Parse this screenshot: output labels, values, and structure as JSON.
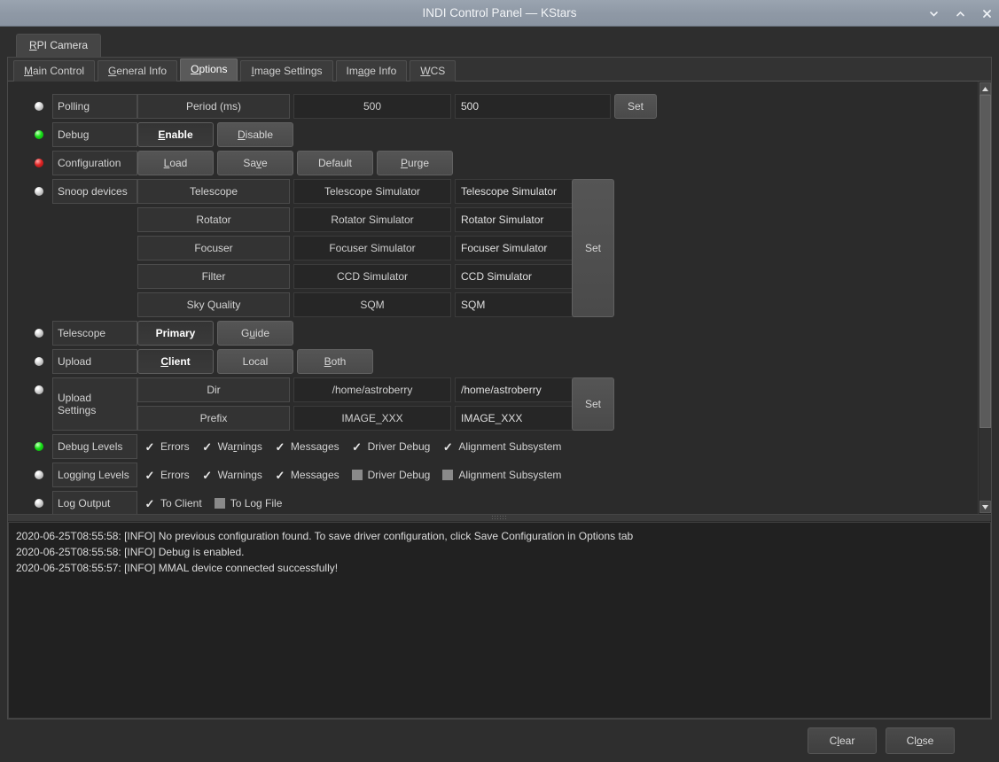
{
  "window": {
    "title": "INDI Control Panel — KStars",
    "controls": [
      {
        "name": "minimize-button",
        "icon": "chevron-down-icon"
      },
      {
        "name": "maximize-button",
        "icon": "chevron-up-icon"
      },
      {
        "name": "close-button",
        "icon": "close-icon"
      }
    ]
  },
  "device_tabs": [
    {
      "label": "RPI Camera",
      "mnemonic": "R",
      "active": true
    }
  ],
  "property_tabs": [
    {
      "label": "Main Control",
      "active": false
    },
    {
      "label": "General Info",
      "active": false
    },
    {
      "label": "Options",
      "active": true
    },
    {
      "label": "Image Settings",
      "active": false
    },
    {
      "label": "Image Info",
      "active": false
    },
    {
      "label": "WCS",
      "active": false
    }
  ],
  "properties": {
    "polling": {
      "led": "idle",
      "label": "Polling",
      "field_label": "Period (ms)",
      "value": "500",
      "edit_value": "500",
      "set_label": "Set"
    },
    "debug": {
      "led": "ok",
      "label": "Debug",
      "enable_label": "Enable",
      "disable_label": "Disable",
      "selected": "Enable"
    },
    "configuration": {
      "led": "alert",
      "label": "Configuration",
      "buttons": [
        "Load",
        "Save",
        "Default",
        "Purge"
      ]
    },
    "snoop_devices": {
      "led": "idle",
      "label": "Snoop devices",
      "set_label": "Set",
      "rows": [
        {
          "field": "Telescope",
          "value": "Telescope Simulator",
          "edit": "Telescope Simulator"
        },
        {
          "field": "Rotator",
          "value": "Rotator Simulator",
          "edit": "Rotator Simulator"
        },
        {
          "field": "Focuser",
          "value": "Focuser Simulator",
          "edit": "Focuser Simulator"
        },
        {
          "field": "Filter",
          "value": "CCD Simulator",
          "edit": "CCD Simulator"
        },
        {
          "field": "Sky Quality",
          "value": "SQM",
          "edit": "SQM"
        }
      ]
    },
    "telescope": {
      "led": "idle",
      "label": "Telescope",
      "primary_label": "Primary",
      "guide_label": "Guide",
      "selected": "Primary"
    },
    "upload": {
      "led": "idle",
      "label": "Upload",
      "client_label": "Client",
      "local_label": "Local",
      "both_label": "Both",
      "selected": "Client"
    },
    "upload_settings": {
      "led": "idle",
      "label": "Upload Settings",
      "set_label": "Set",
      "rows": [
        {
          "field": "Dir",
          "value": "/home/astroberry",
          "edit": "/home/astroberry"
        },
        {
          "field": "Prefix",
          "value": "IMAGE_XXX",
          "edit": "IMAGE_XXX"
        }
      ]
    },
    "debug_levels": {
      "led": "ok",
      "label": "Debug Levels",
      "checks": [
        {
          "label": "Errors",
          "checked": true
        },
        {
          "label": "Warnings",
          "checked": true
        },
        {
          "label": "Messages",
          "checked": true
        },
        {
          "label": "Driver Debug",
          "checked": true
        },
        {
          "label": "Alignment Subsystem",
          "checked": true
        }
      ]
    },
    "logging_levels": {
      "led": "idle",
      "label": "Logging Levels",
      "checks": [
        {
          "label": "Errors",
          "checked": true
        },
        {
          "label": "Warnings",
          "checked": true
        },
        {
          "label": "Messages",
          "checked": true
        },
        {
          "label": "Driver Debug",
          "checked": false
        },
        {
          "label": "Alignment Subsystem",
          "checked": false
        }
      ]
    },
    "log_output": {
      "led": "idle",
      "label": "Log Output",
      "checks": [
        {
          "label": "To Client",
          "checked": true
        },
        {
          "label": "To Log File",
          "checked": false
        }
      ]
    }
  },
  "log": {
    "lines": [
      "2020-06-25T08:55:58: [INFO] No previous configuration found. To save driver configuration, click Save Configuration in Options tab",
      "2020-06-25T08:55:58: [INFO] Debug is enabled.",
      "2020-06-25T08:55:57: [INFO] MMAL device connected successfully!"
    ]
  },
  "footer": {
    "clear_label": "Clear",
    "close_label": "Close"
  },
  "colors": {
    "titlebar": "#8e98a5",
    "led_idle": "#c7c7c7",
    "led_ok": "#17e017",
    "led_alert": "#e02626",
    "panel_bg": "#2b2b2b",
    "field_bg": "#262626"
  }
}
